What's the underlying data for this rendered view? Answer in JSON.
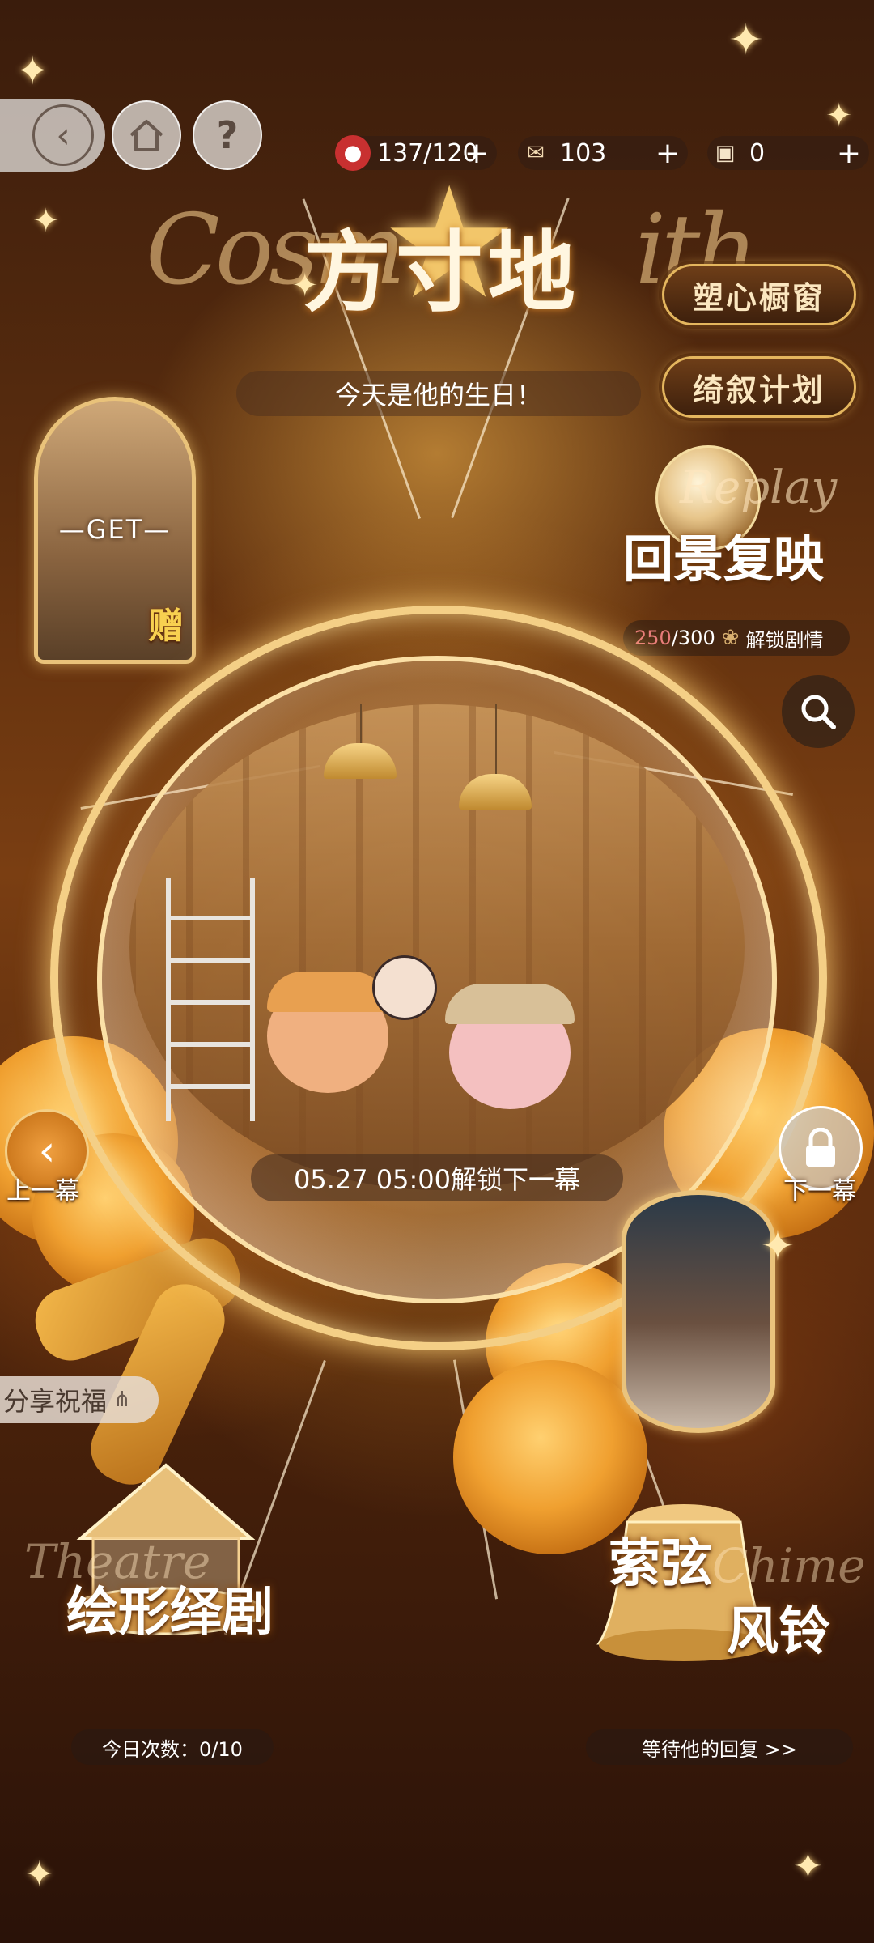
{
  "topbar": {
    "back_icon": "back-arrow-icon",
    "home_icon": "home-icon",
    "help_label": "?",
    "resources": [
      {
        "name": "apple",
        "icon": "apple-icon",
        "value": "137/120",
        "plus": "+"
      },
      {
        "name": "currency",
        "icon": "ticket-icon",
        "value": "103",
        "plus": "+"
      },
      {
        "name": "film",
        "icon": "clapper-icon",
        "value": "0",
        "plus": "+"
      }
    ]
  },
  "header": {
    "title": "方寸地",
    "subtitle": "今天是他的生日！"
  },
  "right_menu": {
    "window_btn": "塑心橱窗",
    "plan_btn": "绮叙计划",
    "replay_label": "回景复映",
    "replay_script": "Replay",
    "progress_current": "250",
    "progress_total": "/300",
    "progress_action": "解锁剧情"
  },
  "left_card": {
    "get_label": "—GET—",
    "gift_label": "赠"
  },
  "scene": {
    "unlock_text": "05.27 05:00解锁下一幕",
    "prev_label": "上一幕",
    "next_label": "下一幕"
  },
  "share": {
    "label": "分享祝福"
  },
  "bottom_left": {
    "label": "绘形绎剧",
    "script": "Theatre",
    "info": "今日次数：0/10"
  },
  "bottom_right": {
    "label_top": "萦弦",
    "label_bottom": "风铃",
    "script": "Chime",
    "info": "等待他的回复 >>"
  },
  "colors": {
    "gold": "#e9c27a",
    "brown_bg": "#5a2d0e",
    "accent_red": "#e87a7a"
  }
}
